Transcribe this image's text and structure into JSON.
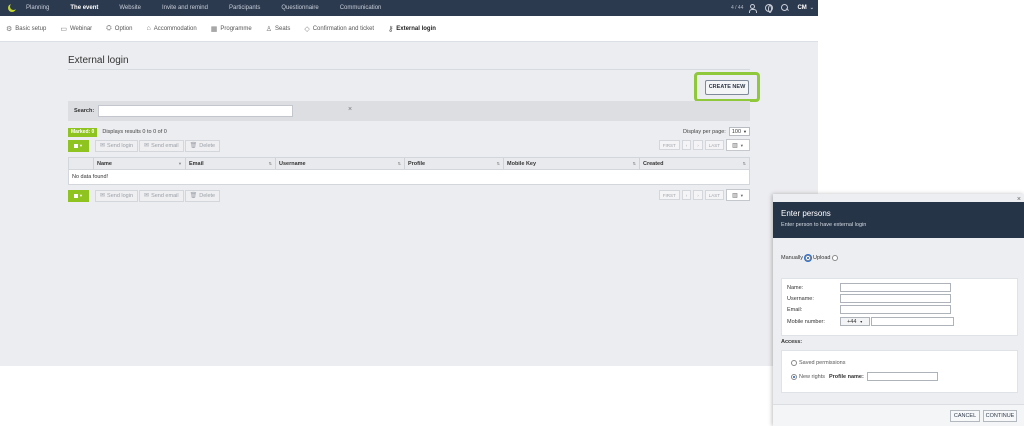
{
  "topnav": {
    "items": [
      "Planning",
      "The event",
      "Website",
      "Invite and remind",
      "Participants",
      "Questionnaire",
      "Communication"
    ],
    "active_index": 1,
    "count": "4 / 44",
    "user_initials": "CM"
  },
  "subnav": {
    "items": [
      {
        "label": "Basic setup",
        "icon": "gear-icon"
      },
      {
        "label": "Webinar",
        "icon": "video-icon"
      },
      {
        "label": "Option",
        "icon": "option-icon"
      },
      {
        "label": "Accommodation",
        "icon": "bed-icon"
      },
      {
        "label": "Programme",
        "icon": "calendar-icon"
      },
      {
        "label": "Seats",
        "icon": "seat-icon"
      },
      {
        "label": "Confirmation and ticket",
        "icon": "ticket-icon"
      },
      {
        "label": "External login",
        "icon": "key-icon"
      }
    ],
    "active_index": 7
  },
  "page": {
    "title": "External login",
    "create_label": "CREATE NEW",
    "highlight_color": "#8fc83a"
  },
  "search": {
    "label": "Search:",
    "value": ""
  },
  "list": {
    "marked_label": "Marked: 0",
    "results_text": "Displays results 0 to 0 of 0",
    "per_page_label": "Display per page:",
    "per_page_value": "100",
    "send_login": "Send login",
    "send_email": "Send email",
    "delete": "Delete",
    "first": "FIRST",
    "prev": "‹",
    "next": "›",
    "last": "LAST",
    "empty_text": "No data found!",
    "columns": [
      "Name",
      "Email",
      "Username",
      "Profile",
      "Mobile Key",
      "Created"
    ]
  },
  "modal": {
    "title": "Enter persons",
    "subtitle": "Enter person to have external login",
    "mode_manually": "Manually",
    "mode_upload": "Upload",
    "name_label": "Name:",
    "username_label": "Username:",
    "email_label": "Email:",
    "mobile_label": "Mobile number:",
    "phone_code": "+44",
    "access_label": "Access:",
    "saved_permissions": "Saved permissions",
    "new_rights": "New rights",
    "profile_name_label": "Profile name:",
    "cancel": "CANCEL",
    "continue": "CONTINUE"
  }
}
